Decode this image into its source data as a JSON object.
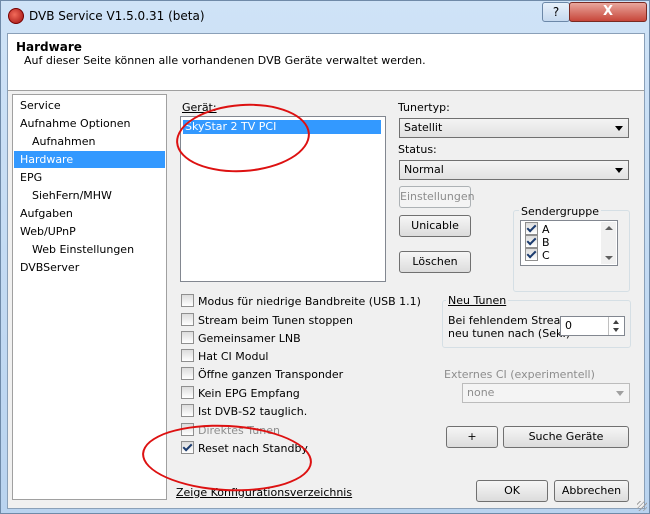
{
  "window": {
    "title": "DVB Service V1.5.0.31 (beta)",
    "help_label": "?",
    "close_label": "X"
  },
  "header": {
    "title": "Hardware",
    "description": "Auf dieser Seite können alle vorhandenen DVB Geräte verwaltet werden."
  },
  "nav": {
    "items": [
      "Service",
      "Aufnahme Optionen",
      "Aufnahmen",
      "Hardware",
      "EPG",
      "SiehFern/MHW",
      "Aufgaben",
      "Web/UPnP",
      "Web Einstellungen",
      "DVBServer"
    ],
    "selected": "Hardware"
  },
  "devices": {
    "label": "Gerät:",
    "items": [
      "SkyStar 2 TV PCI"
    ],
    "selected": "SkyStar 2 TV PCI"
  },
  "tuner": {
    "label": "Tunertyp:",
    "value": "Satellit"
  },
  "status": {
    "label": "Status:",
    "value": "Normal"
  },
  "buttons": {
    "settings": "Einstellungen",
    "unicable": "Unicable",
    "delete": "Löschen",
    "add": "+",
    "search": "Suche Geräte",
    "ok": "OK",
    "cancel": "Abbrechen"
  },
  "sender_group": {
    "label": "Sendergruppe",
    "items": [
      {
        "label": "A",
        "checked": true
      },
      {
        "label": "B",
        "checked": true
      },
      {
        "label": "C",
        "checked": true
      }
    ]
  },
  "options": [
    {
      "label": "Modus für niedrige Bandbreite (USB 1.1)",
      "checked": false,
      "enabled": true
    },
    {
      "label": "Stream beim Tunen stoppen",
      "checked": false,
      "enabled": true
    },
    {
      "label": "Gemeinsamer LNB",
      "checked": false,
      "enabled": true
    },
    {
      "label": "Hat CI Modul",
      "checked": false,
      "enabled": true
    },
    {
      "label": "Öffne ganzen Transponder",
      "checked": false,
      "enabled": true
    },
    {
      "label": "Kein EPG Empfang",
      "checked": false,
      "enabled": true
    },
    {
      "label": "Ist DVB-S2 tauglich.",
      "checked": false,
      "enabled": true
    },
    {
      "label": "Direktes Tunen",
      "checked": false,
      "enabled": false
    },
    {
      "label": "Reset nach Standby",
      "checked": true,
      "enabled": true
    }
  ],
  "retune": {
    "label": "Neu Tunen",
    "text_line1": "Bei fehlendem Stream",
    "text_line2": "neu tunen nach (Sek.)",
    "value": "0"
  },
  "external_ci": {
    "label": "Externes CI (experimentell)",
    "value": "none"
  },
  "config_link": "Zeige Konfigurationsverzeichnis",
  "colors": {
    "selection": "#3399ff",
    "annotation": "#dd1111"
  }
}
